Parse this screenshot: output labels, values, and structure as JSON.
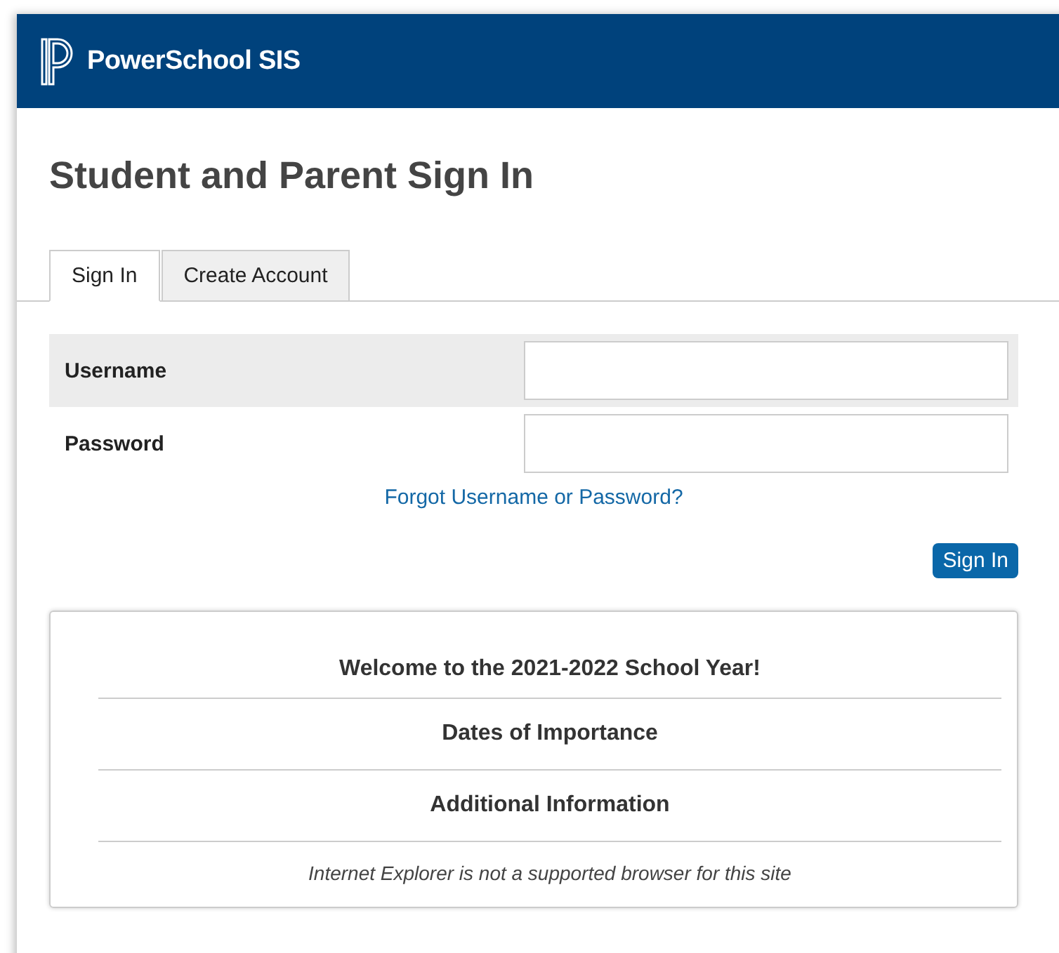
{
  "header": {
    "brand": "PowerSchool SIS"
  },
  "title": "Student and Parent Sign In",
  "tabs": [
    {
      "label": "Sign In",
      "selected": true
    },
    {
      "label": "Create Account",
      "selected": false
    }
  ],
  "fields": [
    {
      "label": "Username",
      "shaded": true
    },
    {
      "label": "Password",
      "shaded": false
    }
  ],
  "forgot_link": "Forgot Username or Password?",
  "submit": "Sign In",
  "info": {
    "headings": [
      "Welcome to the 2021-2022 School Year!",
      "Dates of Importance",
      "Additional Information"
    ],
    "note": "Internet Explorer is not a supported browser for this site"
  }
}
